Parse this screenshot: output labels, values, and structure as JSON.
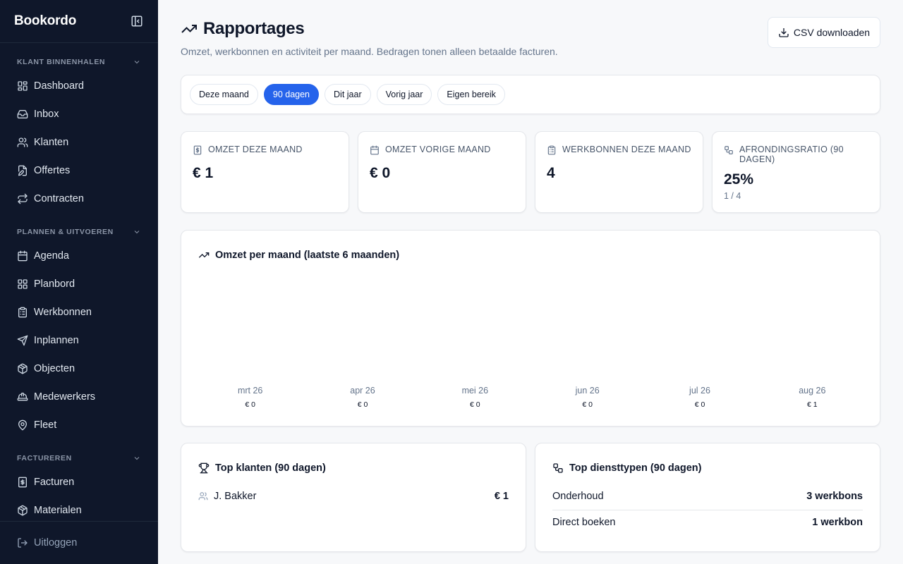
{
  "brand": "Bookordo",
  "sidebar": {
    "sections": [
      {
        "title": "KLANT BINNENHALEN",
        "items": [
          {
            "label": "Dashboard",
            "icon": "dashboard-icon"
          },
          {
            "label": "Inbox",
            "icon": "inbox-icon"
          },
          {
            "label": "Klanten",
            "icon": "users-icon"
          },
          {
            "label": "Offertes",
            "icon": "file-edit-icon"
          },
          {
            "label": "Contracten",
            "icon": "repeat-icon"
          }
        ]
      },
      {
        "title": "PLANNEN & UITVOEREN",
        "items": [
          {
            "label": "Agenda",
            "icon": "calendar-icon"
          },
          {
            "label": "Planbord",
            "icon": "grid-icon"
          },
          {
            "label": "Werkbonnen",
            "icon": "clipboard-icon"
          },
          {
            "label": "Inplannen",
            "icon": "send-icon"
          },
          {
            "label": "Objecten",
            "icon": "boxes-icon"
          },
          {
            "label": "Medewerkers",
            "icon": "hard-hat-icon"
          },
          {
            "label": "Fleet",
            "icon": "map-pin-icon"
          }
        ]
      },
      {
        "title": "FACTUREREN",
        "items": [
          {
            "label": "Facturen",
            "icon": "invoice-icon"
          },
          {
            "label": "Materialen",
            "icon": "package-icon"
          }
        ]
      }
    ],
    "logout": "Uitloggen"
  },
  "header": {
    "title": "Rapportages",
    "subtitle": "Omzet, werkbonnen en activiteit per maand. Bedragen tonen alleen betaalde facturen.",
    "csv_button": "CSV downloaden"
  },
  "ranges": {
    "options": [
      "Deze maand",
      "90 dagen",
      "Dit jaar",
      "Vorig jaar",
      "Eigen bereik"
    ],
    "selected": "90 dagen"
  },
  "kpis": [
    {
      "label": "OMZET DEZE MAAND",
      "value": "€ 1",
      "sub": "",
      "icon": "dollar-file-icon"
    },
    {
      "label": "OMZET VORIGE MAAND",
      "value": "€ 0",
      "sub": "",
      "icon": "calendar-icon"
    },
    {
      "label": "WERKBONNEN DEZE MAAND",
      "value": "4",
      "sub": "",
      "icon": "clipboard-icon"
    },
    {
      "label": "AFRONDINGSRATIO (90 DAGEN)",
      "value": "25%",
      "sub": "1 / 4",
      "icon": "workflow-icon"
    }
  ],
  "chart_title": "Omzet per maand (laatste 6 maanden)",
  "chart_data": {
    "type": "bar",
    "categories": [
      "mrt 26",
      "apr 26",
      "mei 26",
      "jun 26",
      "jul 26",
      "aug 26"
    ],
    "values": [
      0,
      0,
      0,
      0,
      0,
      1
    ],
    "value_labels": [
      "€ 0",
      "€ 0",
      "€ 0",
      "€ 0",
      "€ 0",
      "€ 1"
    ],
    "title": "Omzet per maand (laatste 6 maanden)",
    "grid": false
  },
  "top_clients": {
    "title": "Top klanten (90 dagen)",
    "rows": [
      {
        "name": "J. Bakker",
        "value": "€ 1"
      }
    ]
  },
  "top_services": {
    "title": "Top diensttypen (90 dagen)",
    "rows": [
      {
        "name": "Onderhoud",
        "value": "3 werkbons"
      },
      {
        "name": "Direct boeken",
        "value": "1 werkbon"
      }
    ]
  },
  "colors": {
    "sidebar_bg": "#0f172a",
    "accent": "#2563eb"
  }
}
